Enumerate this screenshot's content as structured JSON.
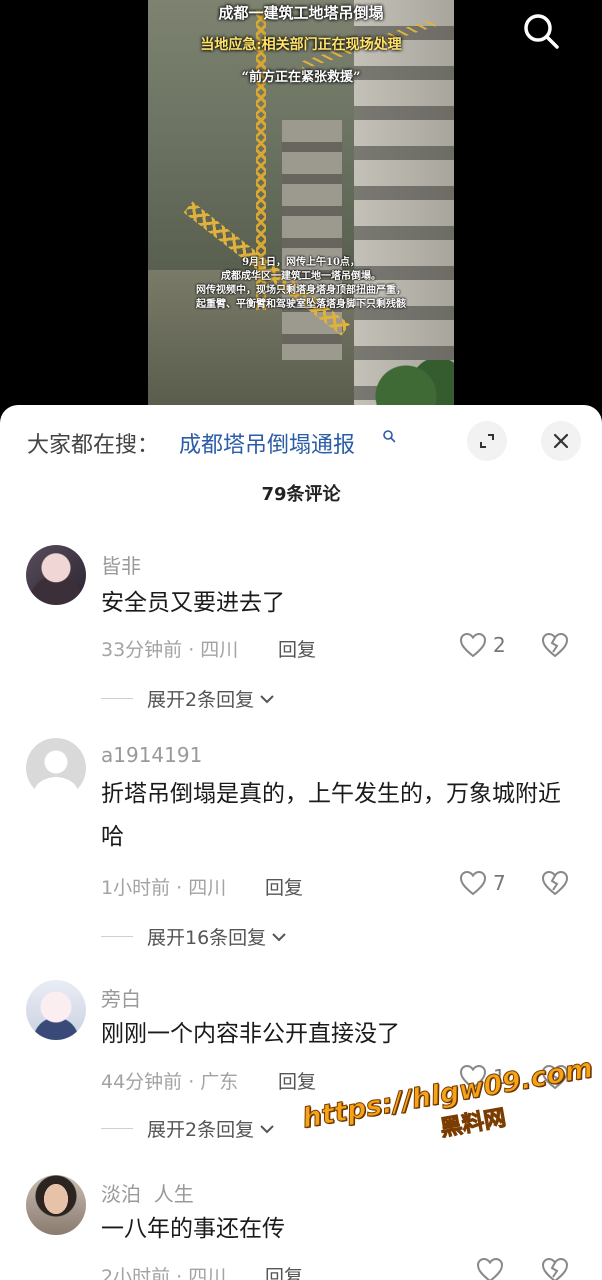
{
  "video": {
    "title_1": "成都一建筑工地塔吊倒塌",
    "title_2": "当地应急:相关部门正在现场处理",
    "title_3": "“前方正在紧张救援”",
    "caption": [
      "9月1日，网传上午10点，",
      "成都成华区一建筑工地一塔吊倒塌。",
      "网传视频中，现场只剩塔身塔身顶部扭曲严重，",
      "起重臂、平衡臂和驾驶室坠落塔身脚下只剩残骸"
    ]
  },
  "top_bar": {
    "search_icon": "search-icon"
  },
  "sheet": {
    "search_prefix": "大家都在搜：",
    "search_link": "成都塔吊倒塌通报",
    "expand_icon": "expand-icon",
    "close_icon": "close-icon",
    "comment_count": "79条评论"
  },
  "comments": [
    {
      "user": "皆非",
      "content": "安全员又要进去了",
      "time": "33分钟前 · 四川",
      "reply_label": "回复",
      "likes": "2",
      "expand_label": "展开2条回复"
    },
    {
      "user": "a1914191",
      "content": "折塔吊倒塌是真的，上午发生的，万象城附近哈",
      "time": "1小时前 · 四川",
      "reply_label": "回复",
      "likes": "7",
      "expand_label": "展开16条回复"
    },
    {
      "user": "旁白",
      "content": "刚刚一个内容非公开直接没了",
      "time": "44分钟前 · 广东",
      "reply_label": "回复",
      "likes": "1",
      "expand_label": "展开2条回复"
    },
    {
      "user": "淡泊  人生",
      "content": "一八年的事还在传",
      "time": "2小时前 · 四川",
      "reply_label": "回复",
      "likes": "",
      "expand_label": ""
    }
  ],
  "watermark": {
    "url": "https://hlgw09.com",
    "name": "黑料网"
  },
  "colors": {
    "link": "#2b5da8",
    "watermark": "#f5a417",
    "crane": "#e1b23b"
  }
}
